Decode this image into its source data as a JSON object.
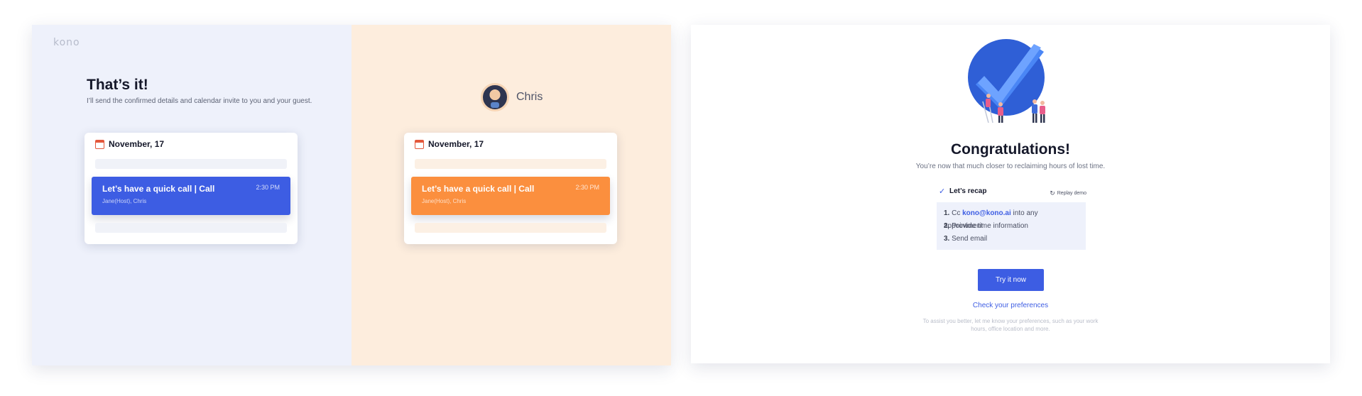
{
  "left_frame": {
    "logo": "kono",
    "title": "That’s it!",
    "subtitle": "I’ll send the confirmed details and calendar invite to you and your guest.",
    "guest_name": "Chris",
    "host_card": {
      "date": "November, 17",
      "event_title": "Let’s have a quick call | Call",
      "event_time": "2:30 PM",
      "event_people": "Jane(Host), Chris",
      "color": "#3d5de3"
    },
    "guest_card": {
      "date": "November, 17",
      "event_title": "Let’s have a quick call | Call",
      "event_time": "2:30 PM",
      "event_people": "Jane(Host), Chris",
      "color": "#fb8f3e"
    },
    "colors": {
      "host_bg": "#eef1fb",
      "guest_bg": "#fdeddd"
    }
  },
  "right_frame": {
    "title": "Congratulations!",
    "subtitle": "You’re now that much closer to reclaiming hours of lost time.",
    "recap_label": "Let’s recap",
    "replay_label": "Replay demo",
    "recap_items": [
      {
        "num": "1.",
        "pre": "Cc ",
        "link": "kono@kono.ai",
        "post": " into any appointment"
      },
      {
        "num": "2.",
        "text": "Provide time information"
      },
      {
        "num": "3.",
        "text": "Send email"
      }
    ],
    "try_button": "Try it now",
    "preferences_link": "Check your preferences",
    "assist_text": "To assist you better, let me know your preferences, such as your work hours, office location and more.",
    "colors": {
      "accent": "#3d5de3"
    }
  }
}
